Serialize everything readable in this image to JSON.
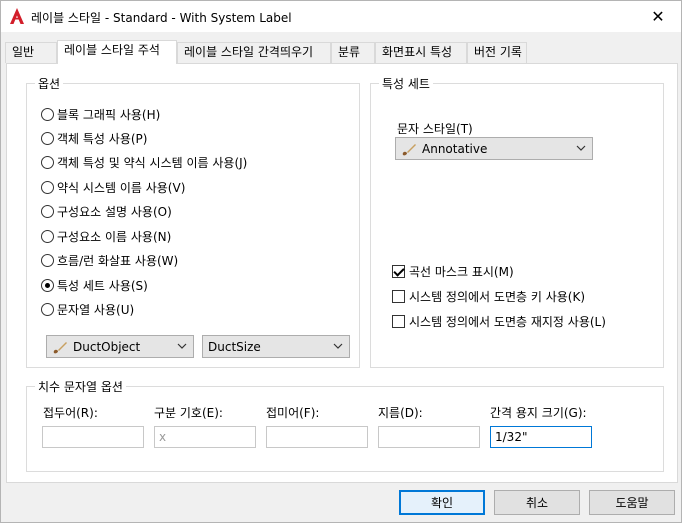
{
  "window": {
    "title": "레이블 스타일 - Standard - With System Label",
    "close_glyph": "✕"
  },
  "tabs": [
    {
      "label": "일반"
    },
    {
      "label": "레이블 스타일 주석"
    },
    {
      "label": "레이블 스타일 간격띄우기"
    },
    {
      "label": "분류"
    },
    {
      "label": "화면표시 특성"
    },
    {
      "label": "버전 기록"
    }
  ],
  "options": {
    "group_label": "옵션",
    "radios": [
      {
        "label": "블록 그래픽 사용(H)",
        "checked": false
      },
      {
        "label": "객체 특성 사용(P)",
        "checked": false
      },
      {
        "label": "객체 특성 및 약식 시스템 이름 사용(J)",
        "checked": false
      },
      {
        "label": "약식 시스템 이름 사용(V)",
        "checked": false
      },
      {
        "label": "구성요소 설명 사용(O)",
        "checked": false
      },
      {
        "label": "구성요소 이름 사용(N)",
        "checked": false
      },
      {
        "label": "흐름/런 화살표 사용(W)",
        "checked": false
      },
      {
        "label": "특성 세트 사용(S)",
        "checked": true
      },
      {
        "label": "문자열 사용(U)",
        "checked": false
      }
    ],
    "object_combo": "DuctObject",
    "size_combo": "DuctSize"
  },
  "propset": {
    "group_label": "특성 세트",
    "text_style_label": "문자 스타일(T)",
    "text_style_value": "Annotative",
    "checks": [
      {
        "label": "곡선 마스크 표시(M)",
        "checked": true
      },
      {
        "label": "시스템 정의에서 도면층 키 사용(K)",
        "checked": false
      },
      {
        "label": "시스템 정의에서 도면층 재지정 사용(L)",
        "checked": false
      }
    ]
  },
  "dimension": {
    "group_label": "치수 문자열 옵션",
    "fields": [
      {
        "label": "접두어(R):",
        "value": "",
        "disabled": false
      },
      {
        "label": "구분 기호(E):",
        "value": "x",
        "disabled": true
      },
      {
        "label": "접미어(F):",
        "value": "",
        "disabled": false
      },
      {
        "label": "지름(D):",
        "value": "",
        "disabled": false
      },
      {
        "label": "간격 용지 크기(G):",
        "value": "1/32\"",
        "disabled": false
      }
    ]
  },
  "buttons": {
    "ok": "확인",
    "cancel": "취소",
    "help": "도움말"
  },
  "colors": {
    "accent": "#0078d7",
    "brand_red": "#d21e2a"
  }
}
